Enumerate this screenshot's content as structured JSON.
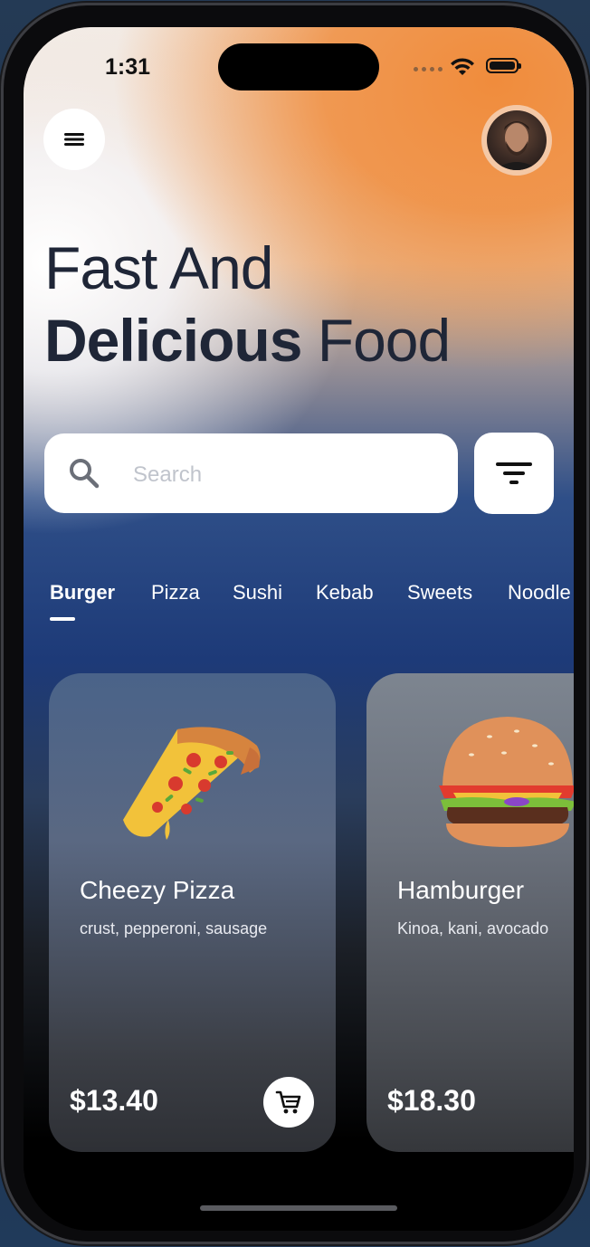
{
  "status_bar": {
    "time": "1:31"
  },
  "header": {
    "menu_icon": "hamburger-menu-icon",
    "avatar": "user-avatar"
  },
  "headline": {
    "line1": "Fast And",
    "line2_bold": "Delicious",
    "line2_rest": " Food"
  },
  "search": {
    "placeholder": "Search",
    "icon": "search-icon",
    "filter_icon": "filter-icon"
  },
  "categories": {
    "active": "Burger",
    "items": [
      "Burger",
      "Pizza",
      "Sushi",
      "Kebab",
      "Sweets",
      "Noodle"
    ]
  },
  "products": [
    {
      "name": "Cheezy Pizza",
      "description": "crust, pepperoni, sausage",
      "price": "$13.40",
      "image": "pizza-slice"
    },
    {
      "name": "Hamburger",
      "description": "Kinoa, kani, avocado",
      "price": "$18.30",
      "image": "burger"
    }
  ],
  "colors": {
    "accent_orange": "#F08C3C",
    "deep_blue": "#1D3A78",
    "headline_text": "#1F2637"
  }
}
